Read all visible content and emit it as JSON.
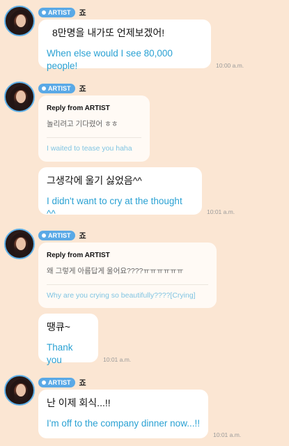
{
  "sender": {
    "badge": "ARTIST",
    "name": "죠"
  },
  "groups": [
    {
      "messages": [
        {
          "ko": "8만명을 내가또 언제보겠어!",
          "en": "When else would I see 80,000 people!",
          "time": "10:00 a.m."
        }
      ]
    },
    {
      "reply": {
        "title": "Reply from ARTIST",
        "ko": "놀리려고 기다렸어 ㅎㅎ",
        "en": "I waited to tease you haha"
      },
      "messages": [
        {
          "ko": "그생각에 울기 싫었음^^",
          "en": "I didn't want to cry at the thought ^^",
          "time": "10:01 a.m."
        }
      ]
    },
    {
      "reply": {
        "title": "Reply from ARTIST",
        "ko": "왜 그렇게 아름답게 울어요????ㅠㅠㅠㅠㅠㅠ",
        "en": "Why are you crying so beautifully????[Crying]"
      },
      "messages": [
        {
          "ko": "땡큐~",
          "en": "Thank you",
          "time": "10:01 a.m."
        }
      ]
    },
    {
      "messages": [
        {
          "ko": "난 이제 회식...!!",
          "en": "I'm off to the company dinner now...!!",
          "time": "10:01 a.m."
        }
      ]
    }
  ]
}
